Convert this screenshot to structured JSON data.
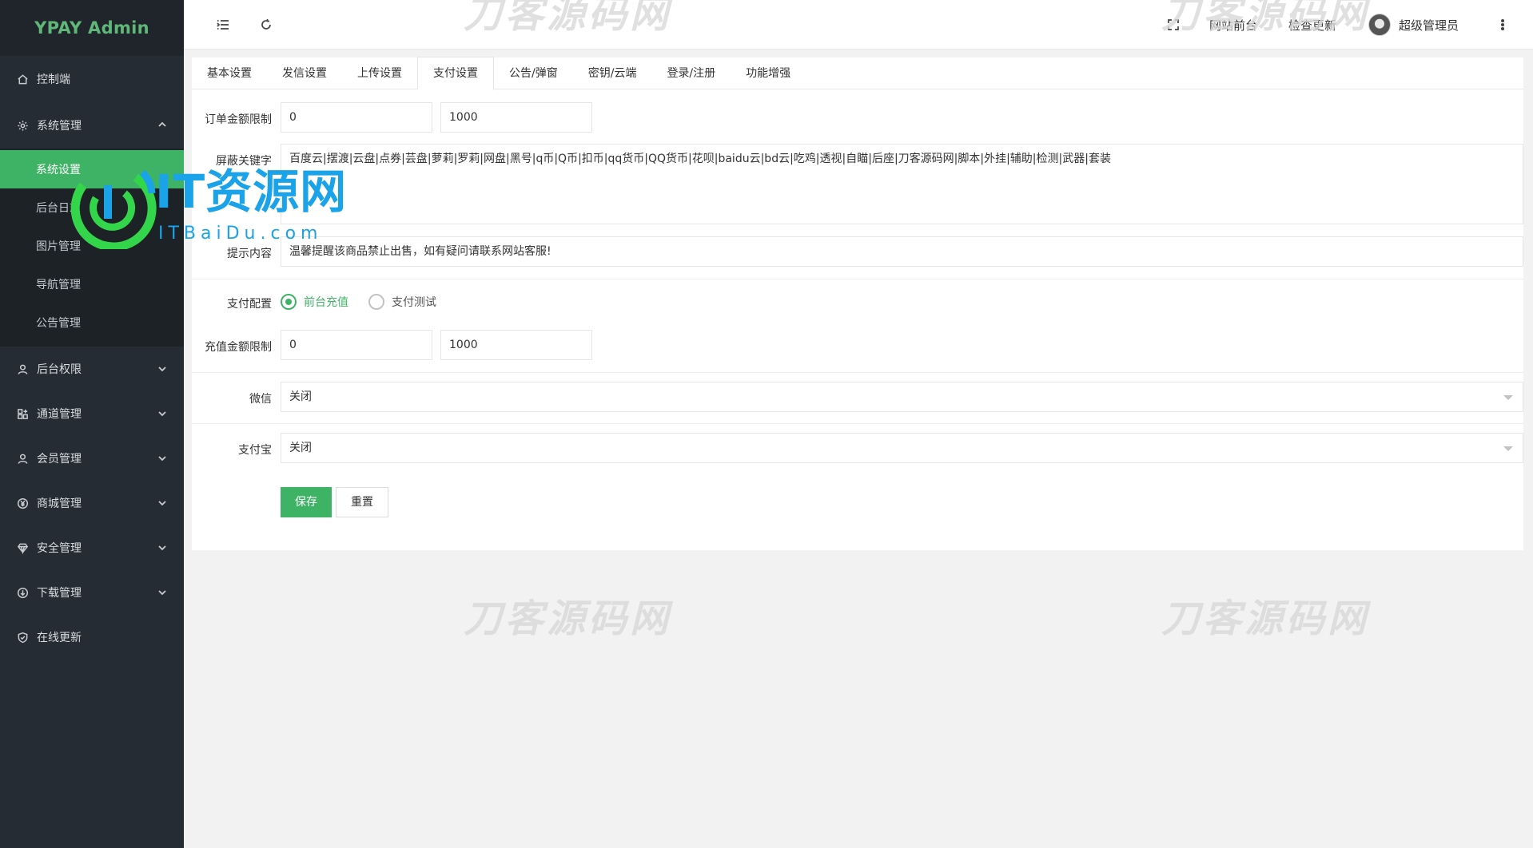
{
  "app": {
    "title": "YPAY Admin",
    "brand_color": "#3fb365",
    "sidebar_bg": "#262c33"
  },
  "sidebar": {
    "items": [
      {
        "label": "控制端",
        "icon": "home-icon"
      },
      {
        "label": "系统管理",
        "icon": "gear-icon",
        "expanded": true,
        "children": [
          {
            "label": "系统设置",
            "active": true
          },
          {
            "label": "后台日志"
          },
          {
            "label": "图片管理"
          },
          {
            "label": "导航管理"
          },
          {
            "label": "公告管理"
          }
        ]
      },
      {
        "label": "后台权限",
        "icon": "user-icon"
      },
      {
        "label": "通道管理",
        "icon": "apps-icon"
      },
      {
        "label": "会员管理",
        "icon": "user-icon"
      },
      {
        "label": "商城管理",
        "icon": "yen-icon"
      },
      {
        "label": "安全管理",
        "icon": "diamond-icon"
      },
      {
        "label": "下载管理",
        "icon": "download-icon"
      },
      {
        "label": "在线更新",
        "icon": "shield-icon"
      }
    ]
  },
  "header": {
    "site_front": "网站前台",
    "check_update": "检查更新",
    "username": "超级管理员"
  },
  "tabs": [
    "基本设置",
    "发信设置",
    "上传设置",
    "支付设置",
    "公告/弹窗",
    "密钥/云端",
    "登录/注册",
    "功能增强"
  ],
  "active_tab": "支付设置",
  "form": {
    "order_limit": {
      "label": "订单金额限制",
      "min": "0",
      "max": "1000"
    },
    "blocked_keywords": {
      "label": "屏蔽关键字",
      "value": "百度云|摆渡|云盘|点券|芸盘|萝莉|罗莉|网盘|黑号|q币|Q币|扣币|qq货币|QQ货币|花呗|baidu云|bd云|吃鸡|透视|自瞄|后座|刀客源码网|脚本|外挂|辅助|检测|武器|套装"
    },
    "tip_content": {
      "label": "提示内容",
      "value": "温馨提醒该商品禁止出售，如有疑问请联系网站客服!"
    },
    "pay_config": {
      "label": "支付配置",
      "options": [
        "前台充值",
        "支付测试"
      ],
      "selected": "前台充值"
    },
    "recharge_limit": {
      "label": "充值金额限制",
      "min": "0",
      "max": "1000"
    },
    "wechat": {
      "label": "微信",
      "value": "关闭"
    },
    "alipay": {
      "label": "支付宝",
      "value": "关闭"
    },
    "save_label": "保存",
    "reset_label": "重置"
  },
  "watermarks": {
    "site": "刀客源码网",
    "it_logo_main": "IT资源网",
    "it_logo_sub": "ITBaiDu.com"
  }
}
